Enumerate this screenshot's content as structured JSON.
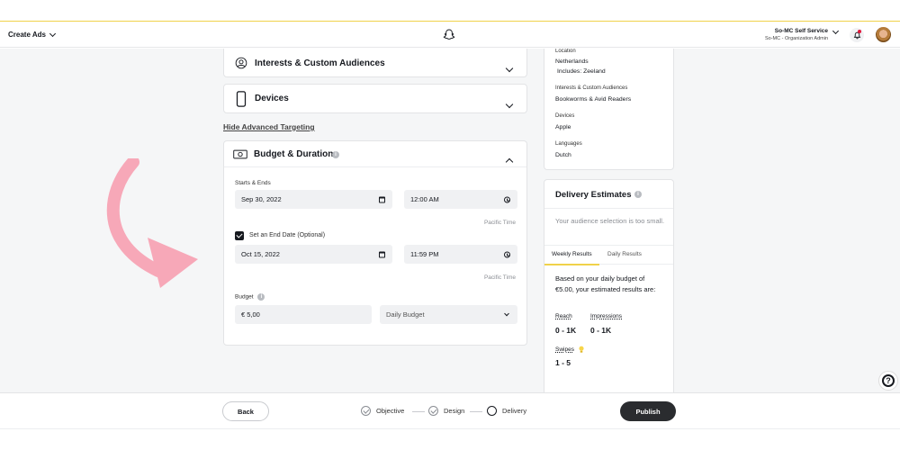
{
  "header": {
    "create_ads": "Create Ads",
    "account_name": "So-MC Self Service",
    "account_sub": "So-MC - Organization Admin"
  },
  "targeting": {
    "interests_title": "Interests & Custom Audiences",
    "devices_title": "Devices",
    "hide_advanced": "Hide Advanced Targeting"
  },
  "budget_card": {
    "title": "Budget & Duration",
    "starts_label": "Starts & Ends",
    "start_date": "Sep 30, 2022",
    "start_time": "12:00 AM",
    "timezone": "Pacific Time",
    "end_date_label": "Set an End Date (Optional)",
    "end_date": "Oct 15, 2022",
    "end_time": "11:59 PM",
    "budget_label": "Budget",
    "budget_value": "€ 5,00",
    "budget_type": "Daily Budget"
  },
  "summary": {
    "location_label": "Location",
    "location_value": "Netherlands",
    "location_includes": "Includes: Zeeland",
    "interests_label": "Interests & Custom Audiences",
    "interests_value": "Bookworms & Avid Readers",
    "devices_label": "Devices",
    "devices_value": "Apple",
    "languages_label": "Languages",
    "languages_value": "Dutch"
  },
  "delivery": {
    "title": "Delivery Estimates",
    "note": "Your audience selection is too small.",
    "tab_weekly": "Weekly Results",
    "tab_daily": "Daily Results",
    "description": "Based on your daily budget of €5.00, your estimated results are:",
    "reach_label": "Reach",
    "reach_value": "0 - 1K",
    "impressions_label": "Impressions",
    "impressions_value": "0 - 1K",
    "swipes_label": "Swipes",
    "swipes_value": "1 - 5"
  },
  "footer": {
    "back": "Back",
    "step_objective": "Objective",
    "step_design": "Design",
    "step_delivery": "Delivery",
    "publish": "Publish"
  },
  "colors": {
    "accent_yellow": "#f0d24a",
    "arrow_pink": "#f7a8b8",
    "publish_bg": "#2a2c2f"
  }
}
